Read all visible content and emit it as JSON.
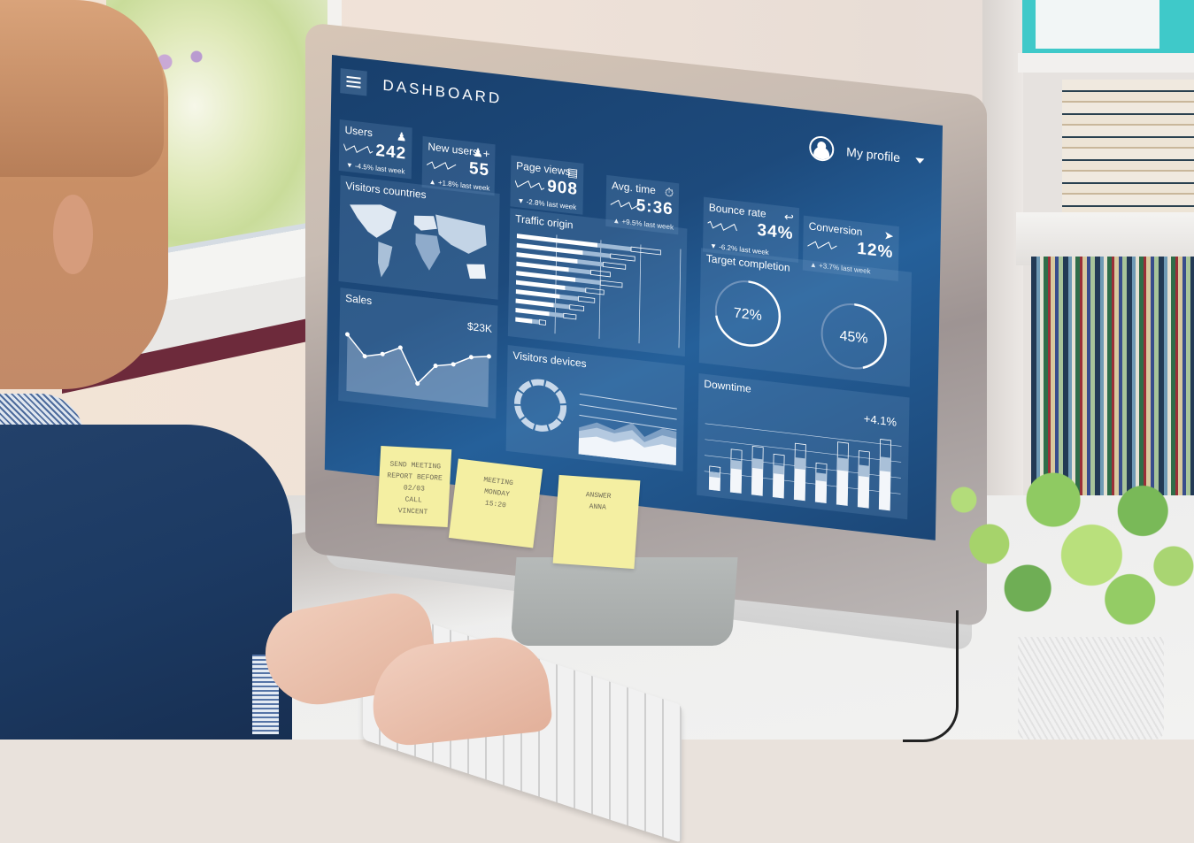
{
  "scene": {
    "description": "Person at a desk typing on a keyboard while viewing an analytics dashboard on a desktop monitor",
    "colors": {
      "screen_bg": "#1d4a7c",
      "panel_bg": "#3f6f9f",
      "sticky_note": "#f4efa2",
      "wall_trim": "#6d2a3b",
      "binder": "#3fc9c9",
      "sweater": "#1c3a63"
    }
  },
  "dashboard": {
    "title": "DASHBOARD",
    "menu_icon": "hamburger-icon",
    "profile": {
      "label": "My profile",
      "icon": "user-avatar-icon",
      "caret": "caret-down-icon"
    },
    "stats": [
      {
        "label": "Users",
        "value": "242",
        "delta": "-4.5% last week",
        "trend": "down",
        "icon": "user-icon"
      },
      {
        "label": "New users",
        "value": "55",
        "delta": "+1.8% last week",
        "trend": "up",
        "icon": "add-user-icon"
      },
      {
        "label": "Page views",
        "value": "908",
        "delta": "-2.8% last week",
        "trend": "down",
        "icon": "document-icon"
      },
      {
        "label": "Avg. time",
        "value": "5:36",
        "delta": "+9.5% last week",
        "trend": "up",
        "icon": "stopwatch-icon"
      },
      {
        "label": "Bounce rate",
        "value": "34%",
        "delta": "-6.2% last week",
        "trend": "down",
        "icon": "return-arrow-icon"
      },
      {
        "label": "Conversion",
        "value": "12%",
        "delta": "+3.7% last week",
        "trend": "up",
        "icon": "cursor-arrow-icon"
      }
    ],
    "trend_glyphs": {
      "up": "▲",
      "down": "▼"
    },
    "visitors_countries": {
      "title": "Visitors countries"
    },
    "traffic_origin": {
      "title": "Traffic origin",
      "bars": [
        0.95,
        0.78,
        0.72,
        0.62,
        0.7,
        0.58,
        0.52,
        0.45,
        0.4,
        0.2
      ]
    },
    "target_completion": {
      "title": "Target completion",
      "gauges": [
        {
          "value": 72,
          "label": "72%"
        },
        {
          "value": 45,
          "label": "45%"
        }
      ]
    },
    "sales": {
      "title": "Sales",
      "total_label": "$23K",
      "points": [
        0.8,
        0.52,
        0.58,
        0.7,
        0.22,
        0.5,
        0.55,
        0.68,
        0.72
      ]
    },
    "visitors_devices": {
      "title": "Visitors devices"
    },
    "downtime": {
      "title": "Downtime",
      "change_label": "+4.1%",
      "bars": [
        0.3,
        0.55,
        0.62,
        0.55,
        0.72,
        0.5,
        0.8,
        0.72,
        0.9
      ]
    }
  },
  "sticky_notes": [
    {
      "lines": [
        "SEND MEETING",
        "REPORT BEFORE",
        "02/03",
        "CALL",
        "VINCENT"
      ]
    },
    {
      "lines": [
        "MEETING",
        "MONDAY",
        "15:20"
      ]
    },
    {
      "lines": [
        "ANSWER",
        "ANNA"
      ]
    }
  ]
}
